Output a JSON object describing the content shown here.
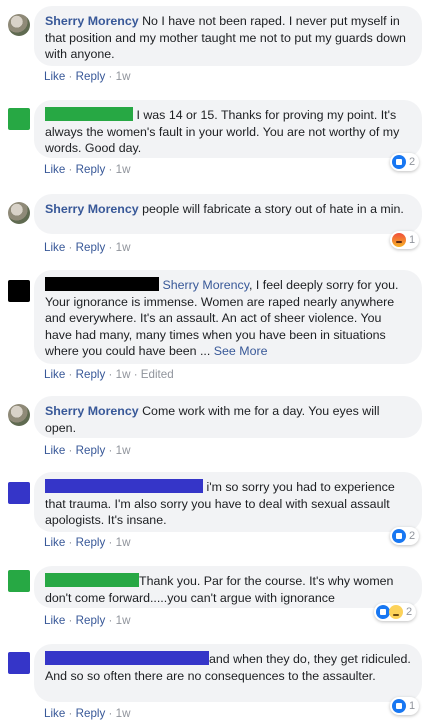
{
  "colors": {
    "green": "#27a844",
    "blue": "#3535c8",
    "black": "#000000",
    "link": "#385898"
  },
  "actions": {
    "like": "Like",
    "reply": "Reply",
    "sep": "·",
    "edited": "Edited"
  },
  "comments": [
    {
      "author": "Sherry Morency",
      "text": "No I have not been raped. I never put myself in that position and my mother taught me not to put my guards down with anyone.",
      "time": "1w"
    },
    {
      "author_redacted": true,
      "text": "I was 14 or 15. Thanks for proving my point. It's always the women's fault in your world. You are not worthy of my words. Good day.",
      "time": "1w",
      "reaction": {
        "icons": [
          "like-icon"
        ],
        "count": "2"
      }
    },
    {
      "author": "Sherry Morency",
      "text": "people will fabricate a story out of hate in a min.",
      "time": "1w",
      "reaction": {
        "icons": [
          "angry-icon"
        ],
        "count": "1"
      }
    },
    {
      "author_redacted": true,
      "mention": "Sherry Morency",
      "text": ", I feel deeply sorry for you. Your ignorance is immense. Women are raped nearly anywhere and everywhere. It's an assault. An act of sheer violence. You have had many, many times when you have been in situations where you could have been ... ",
      "see_more": "See More",
      "time": "1w",
      "edited": true
    },
    {
      "author": "Sherry Morency",
      "text": "Come work with me for a day. You eyes will open.",
      "time": "1w"
    },
    {
      "author_redacted": true,
      "text": "i'm so sorry you had to experience that trauma. I'm also sorry you have to deal with sexual assault apologists. It's insane.",
      "time": "1w",
      "reaction": {
        "icons": [
          "like-icon"
        ],
        "count": "2"
      }
    },
    {
      "author_redacted": true,
      "text": "Thank you. Par for the course. It's why women don't come forward.....you can't argue with ignorance",
      "time": "1w",
      "reaction": {
        "icons": [
          "like-icon",
          "sad-icon"
        ],
        "count": "2"
      }
    },
    {
      "author_redacted": true,
      "text": "and when they do, they get ridiculed. And so so often there are no consequences to the assaulter.",
      "time": "1w",
      "reaction": {
        "icons": [
          "like-icon"
        ],
        "count": "1"
      }
    }
  ]
}
